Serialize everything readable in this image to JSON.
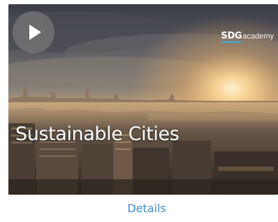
{
  "card": {
    "title": "Sustainable Cities",
    "logo": {
      "primary": "SDG",
      "secondary": "academy"
    },
    "details_label": "Details"
  },
  "icons": {
    "play": "play-icon"
  },
  "colors": {
    "link": "#3d8fd1",
    "logo_underline": "#33b4e6",
    "play_button_bg": "#787878"
  }
}
